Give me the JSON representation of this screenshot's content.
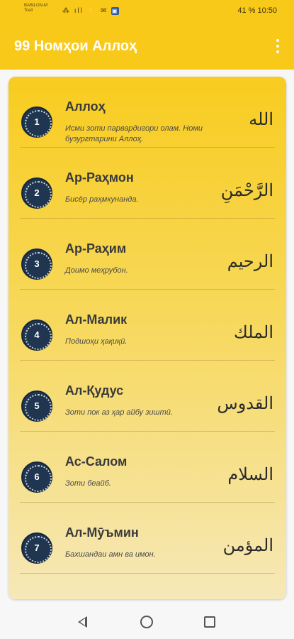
{
  "status_bar": {
    "carrier_line1": "BABILON-M",
    "carrier_line2": "Tcell",
    "icons": "⁂ ıll ⚡ ✉",
    "right_text": "41 %  10:50"
  },
  "app_bar": {
    "title": "99 Номҳои Аллоҳ",
    "menu_icon": "more-vert-icon"
  },
  "names": [
    {
      "number": "1",
      "name": "Аллоҳ",
      "desc": "Исми зоти парвардигори олам. Номи бузургтарини Аллоҳ.",
      "arabic": "الله"
    },
    {
      "number": "2",
      "name": "Ар-Раҳмон",
      "desc": "Бисёр раҳмкунанда.",
      "arabic": "الرَّحْمَنِ"
    },
    {
      "number": "3",
      "name": "Ар-Раҳим",
      "desc": "Доимо меҳрубон.",
      "arabic": "الرحيم"
    },
    {
      "number": "4",
      "name": "Ал-Малик",
      "desc": "Подшоҳи ҳақиқӣ.",
      "arabic": "الملك"
    },
    {
      "number": "5",
      "name": "Ал-Қудус",
      "desc": "Зоти пок аз ҳар айбу зиштӣ.",
      "arabic": "القدوس"
    },
    {
      "number": "6",
      "name": "Ас-Салом",
      "desc": "Зоти беайб.",
      "arabic": "السلام"
    },
    {
      "number": "7",
      "name": "Ал-Мӯъмин",
      "desc": "Бахшандаи амн ва имон.",
      "arabic": "المؤمن"
    }
  ],
  "colors": {
    "accent": "#f9c91a",
    "badge": "#1f3550"
  }
}
